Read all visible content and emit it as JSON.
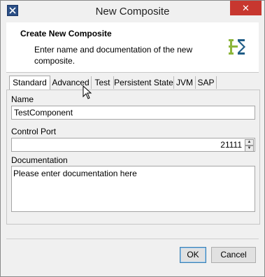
{
  "window": {
    "title": "New Composite",
    "close_glyph": "✕"
  },
  "header": {
    "title": "Create New Composite",
    "description": "Enter name and documentation of the new composite.",
    "logo_colors": [
      "#8db63c",
      "#1f5c86"
    ]
  },
  "tabs": [
    {
      "label": "Standard",
      "active": true
    },
    {
      "label": "Advanced",
      "active": false
    },
    {
      "label": "Test",
      "active": false
    },
    {
      "label": "Persistent State",
      "active": false
    },
    {
      "label": "JVM",
      "active": false
    },
    {
      "label": "SAP",
      "active": false
    }
  ],
  "form": {
    "name_label": "Name",
    "name_value": "TestComponent",
    "port_label": "Control Port",
    "port_value": "21111",
    "doc_label": "Documentation",
    "doc_value": "Please enter documentation here"
  },
  "buttons": {
    "ok_label": "OK",
    "cancel_label": "Cancel"
  },
  "colors": {
    "close_button": "#c7372f",
    "default_button_border": "#3c7fb1"
  }
}
